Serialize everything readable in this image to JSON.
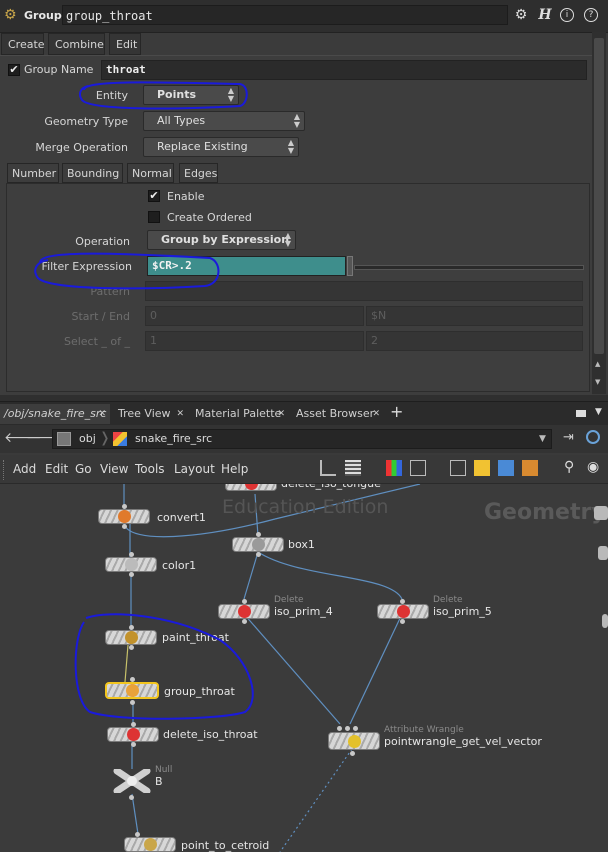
{
  "param_pane": {
    "node_type": "Group",
    "node_name": "group_throat",
    "help_icon": "H",
    "top_tabs": [
      "Create",
      "Combine",
      "Edit"
    ],
    "group_name_label": "Group Name",
    "group_name_value": "throat",
    "entity_label": "Entity",
    "entity_value": "Points",
    "geometry_type_label": "Geometry Type",
    "geometry_type_value": "All Types",
    "merge_label": "Merge Operation",
    "merge_value": "Replace Existing",
    "sub_tabs": [
      "Number",
      "Bounding",
      "Normal",
      "Edges"
    ],
    "enable_label": "Enable",
    "enable_checked": true,
    "create_ordered_label": "Create Ordered",
    "create_ordered_checked": false,
    "operation_label": "Operation",
    "operation_value": "Group by Expression",
    "filter_label": "Filter Expression",
    "filter_value": "$CR>.2",
    "pattern_label": "Pattern",
    "start_end_label": "Start / End",
    "start_value": "0",
    "end_value": "$N",
    "select_label": "Select _ of _",
    "select_a": "1",
    "select_b": "2",
    "annotation_color": "#1a1adb"
  },
  "pane_tabs": [
    "/obj/snake_fire_src",
    "Tree View",
    "Material Palette",
    "Asset Browser"
  ],
  "path": {
    "root": "obj",
    "current": "snake_fire_src"
  },
  "net_menu": [
    "Add",
    "Edit",
    "Go",
    "View",
    "Tools",
    "Layout",
    "Help"
  ],
  "network": {
    "watermark": "Education Edition",
    "context_label": "Geometry",
    "nodes": {
      "delete_iso_tongue": "delete_iso_tongue",
      "convert1": "convert1",
      "box1": "box1",
      "color1": "color1",
      "iso_prim_4": "iso_prim_4",
      "iso_prim_4_type": "Delete",
      "iso_prim_5": "iso_prim_5",
      "iso_prim_5_type": "Delete",
      "paint_throat": "paint_throat",
      "group_throat": "group_throat",
      "delete_iso_throat": "delete_iso_throat",
      "pointwrangle": "pointwrangle_get_vel_vector",
      "pointwrangle_type": "Attribute Wrangle",
      "null_b": "B",
      "null_b_type": "Null",
      "point_to_cetroid": "point_to_cetroid"
    }
  }
}
